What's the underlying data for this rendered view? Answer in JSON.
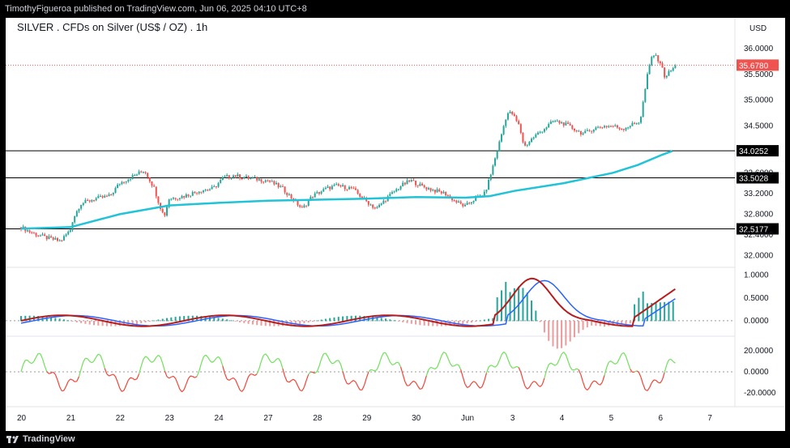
{
  "header": {
    "publisher_text": "TimothyFigueroa published on TradingView.com, Jun 06, 2025 04:10 UTC+8"
  },
  "footer": {
    "brand": "TradingView"
  },
  "chart_title": "SILVER . CFDs on Silver (US$ / OZ) . 1h",
  "currency_label": "USD",
  "colors": {
    "up": "#26a69a",
    "down": "#ef5350",
    "ma": "#21c3d6",
    "price_line": "#ef5350",
    "macd_green": "#4caf50",
    "macd_red": "#b71c1c",
    "macd_blue": "#2962ff",
    "rsi_green": "#6fe05a",
    "rsi_red": "#f44336"
  },
  "chart_data": {
    "type": "candlestick",
    "x_labels": [
      "20",
      "21",
      "22",
      "23",
      "24",
      "27",
      "28",
      "29",
      "30",
      "Jun",
      "3",
      "4",
      "5",
      "6",
      "7"
    ],
    "price_axis": {
      "ticks": [
        "36.0000",
        "35.5000",
        "35.0000",
        "34.5000",
        "33.6000",
        "33.2000",
        "32.8000",
        "32.4000",
        "32.0000"
      ],
      "ylim": [
        31.9,
        36.2
      ],
      "current_price": "35.6780"
    },
    "horizontal_levels": [
      {
        "label": "34.0252",
        "value": 34.0252
      },
      {
        "label": "33.5028",
        "value": 33.5028
      },
      {
        "label": "32.5177",
        "value": 32.5177
      }
    ],
    "price_path": [
      [
        0,
        32.55
      ],
      [
        0.2,
        32.45
      ],
      [
        0.5,
        32.35
      ],
      [
        0.8,
        32.28
      ],
      [
        1.0,
        32.5
      ],
      [
        1.05,
        32.7
      ],
      [
        1.2,
        33.0
      ],
      [
        1.5,
        33.1
      ],
      [
        1.8,
        33.15
      ],
      [
        2.0,
        33.4
      ],
      [
        2.3,
        33.55
      ],
      [
        2.5,
        33.65
      ],
      [
        2.7,
        33.3
      ],
      [
        2.8,
        33.0
      ],
      [
        2.9,
        32.75
      ],
      [
        3.0,
        33.1
      ],
      [
        3.3,
        33.15
      ],
      [
        3.6,
        33.25
      ],
      [
        3.9,
        33.3
      ],
      [
        4.1,
        33.5
      ],
      [
        4.3,
        33.55
      ],
      [
        4.6,
        33.5
      ],
      [
        5.0,
        33.45
      ],
      [
        5.3,
        33.3
      ],
      [
        5.5,
        33.1
      ],
      [
        5.7,
        32.9
      ],
      [
        5.9,
        33.15
      ],
      [
        6.2,
        33.3
      ],
      [
        6.4,
        33.35
      ],
      [
        6.7,
        33.3
      ],
      [
        7.0,
        33.05
      ],
      [
        7.2,
        32.9
      ],
      [
        7.4,
        33.1
      ],
      [
        7.7,
        33.35
      ],
      [
        7.9,
        33.45
      ],
      [
        8.1,
        33.35
      ],
      [
        8.4,
        33.25
      ],
      [
        8.6,
        33.2
      ],
      [
        8.8,
        33.05
      ],
      [
        9.0,
        32.95
      ],
      [
        9.2,
        33.1
      ],
      [
        9.4,
        33.2
      ],
      [
        9.5,
        33.5
      ],
      [
        9.7,
        34.2
      ],
      [
        9.85,
        34.75
      ],
      [
        9.95,
        34.75
      ],
      [
        10.1,
        34.5
      ],
      [
        10.2,
        34.1
      ],
      [
        10.4,
        34.3
      ],
      [
        10.6,
        34.45
      ],
      [
        10.8,
        34.6
      ],
      [
        11.0,
        34.55
      ],
      [
        11.2,
        34.45
      ],
      [
        11.4,
        34.35
      ],
      [
        11.6,
        34.45
      ],
      [
        11.8,
        34.5
      ],
      [
        12.0,
        34.5
      ],
      [
        12.2,
        34.45
      ],
      [
        12.55,
        34.6
      ],
      [
        12.7,
        35.5
      ],
      [
        12.8,
        35.9
      ],
      [
        12.95,
        35.75
      ],
      [
        13.05,
        35.45
      ],
      [
        13.25,
        35.65
      ]
    ],
    "ma_path": [
      [
        0,
        32.52
      ],
      [
        1,
        32.55
      ],
      [
        2,
        32.8
      ],
      [
        3,
        32.97
      ],
      [
        4,
        33.02
      ],
      [
        5,
        33.06
      ],
      [
        6,
        33.08
      ],
      [
        7,
        33.1
      ],
      [
        8,
        33.13
      ],
      [
        9,
        33.12
      ],
      [
        9.5,
        33.15
      ],
      [
        10,
        33.25
      ],
      [
        11,
        33.4
      ],
      [
        12,
        33.6
      ],
      [
        12.5,
        33.75
      ],
      [
        13,
        33.95
      ],
      [
        13.2,
        34.02
      ]
    ],
    "macd": {
      "ylim": [
        -0.25,
        1.1
      ],
      "ticks": [
        "1.0000",
        "0.5000",
        "0.0000"
      ],
      "zero_line": "0.0000"
    },
    "rsi": {
      "ylim": [
        -30,
        30
      ],
      "ticks": [
        "20.0000",
        "0.0000",
        "-20.0000"
      ]
    }
  }
}
